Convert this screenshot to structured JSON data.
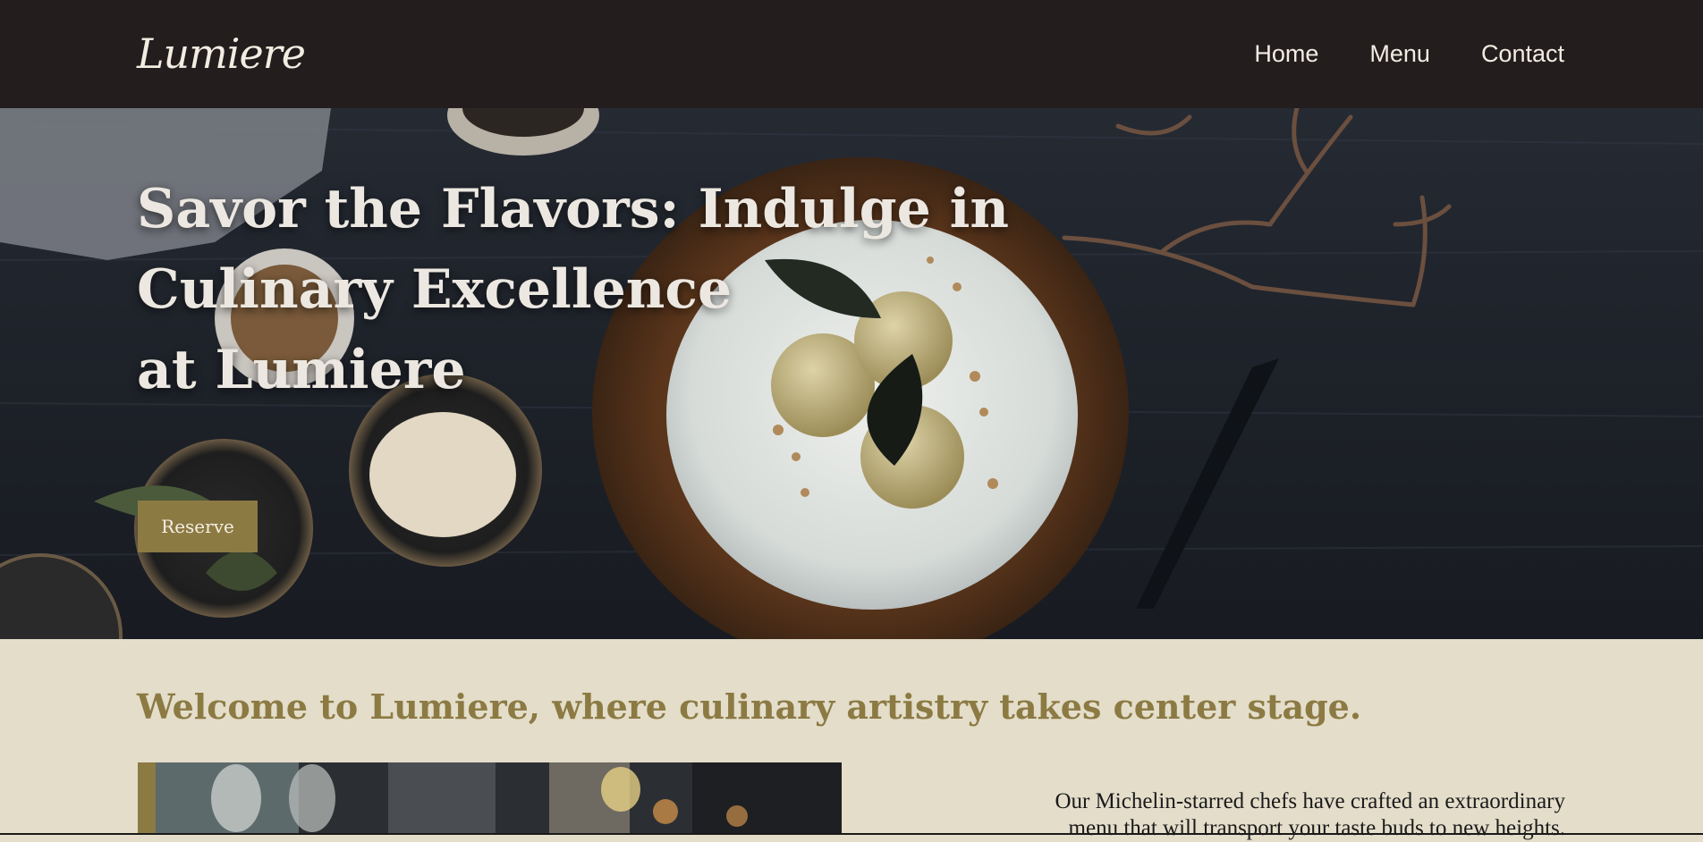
{
  "brand": {
    "logo_text": "Lumiere"
  },
  "nav": {
    "items": [
      {
        "label": "Home"
      },
      {
        "label": "Menu"
      },
      {
        "label": "Contact"
      }
    ]
  },
  "hero": {
    "title_line1": "Savor the Flavors: Indulge in",
    "title_line2": "Culinary Excellence",
    "title_line3": "at Lumiere",
    "reserve_label": "Reserve"
  },
  "welcome": {
    "heading": "Welcome to Lumiere, where culinary artistry takes center stage.",
    "body_line1": "Our Michelin-starred chefs have crafted an extraordinary",
    "body_line2": "menu that will transport your taste buds to new heights."
  },
  "colors": {
    "header_bg": "#231d1e",
    "accent_gold": "#8c7a43",
    "section_bg": "#e3ddca",
    "text_light": "#f2ede2"
  }
}
